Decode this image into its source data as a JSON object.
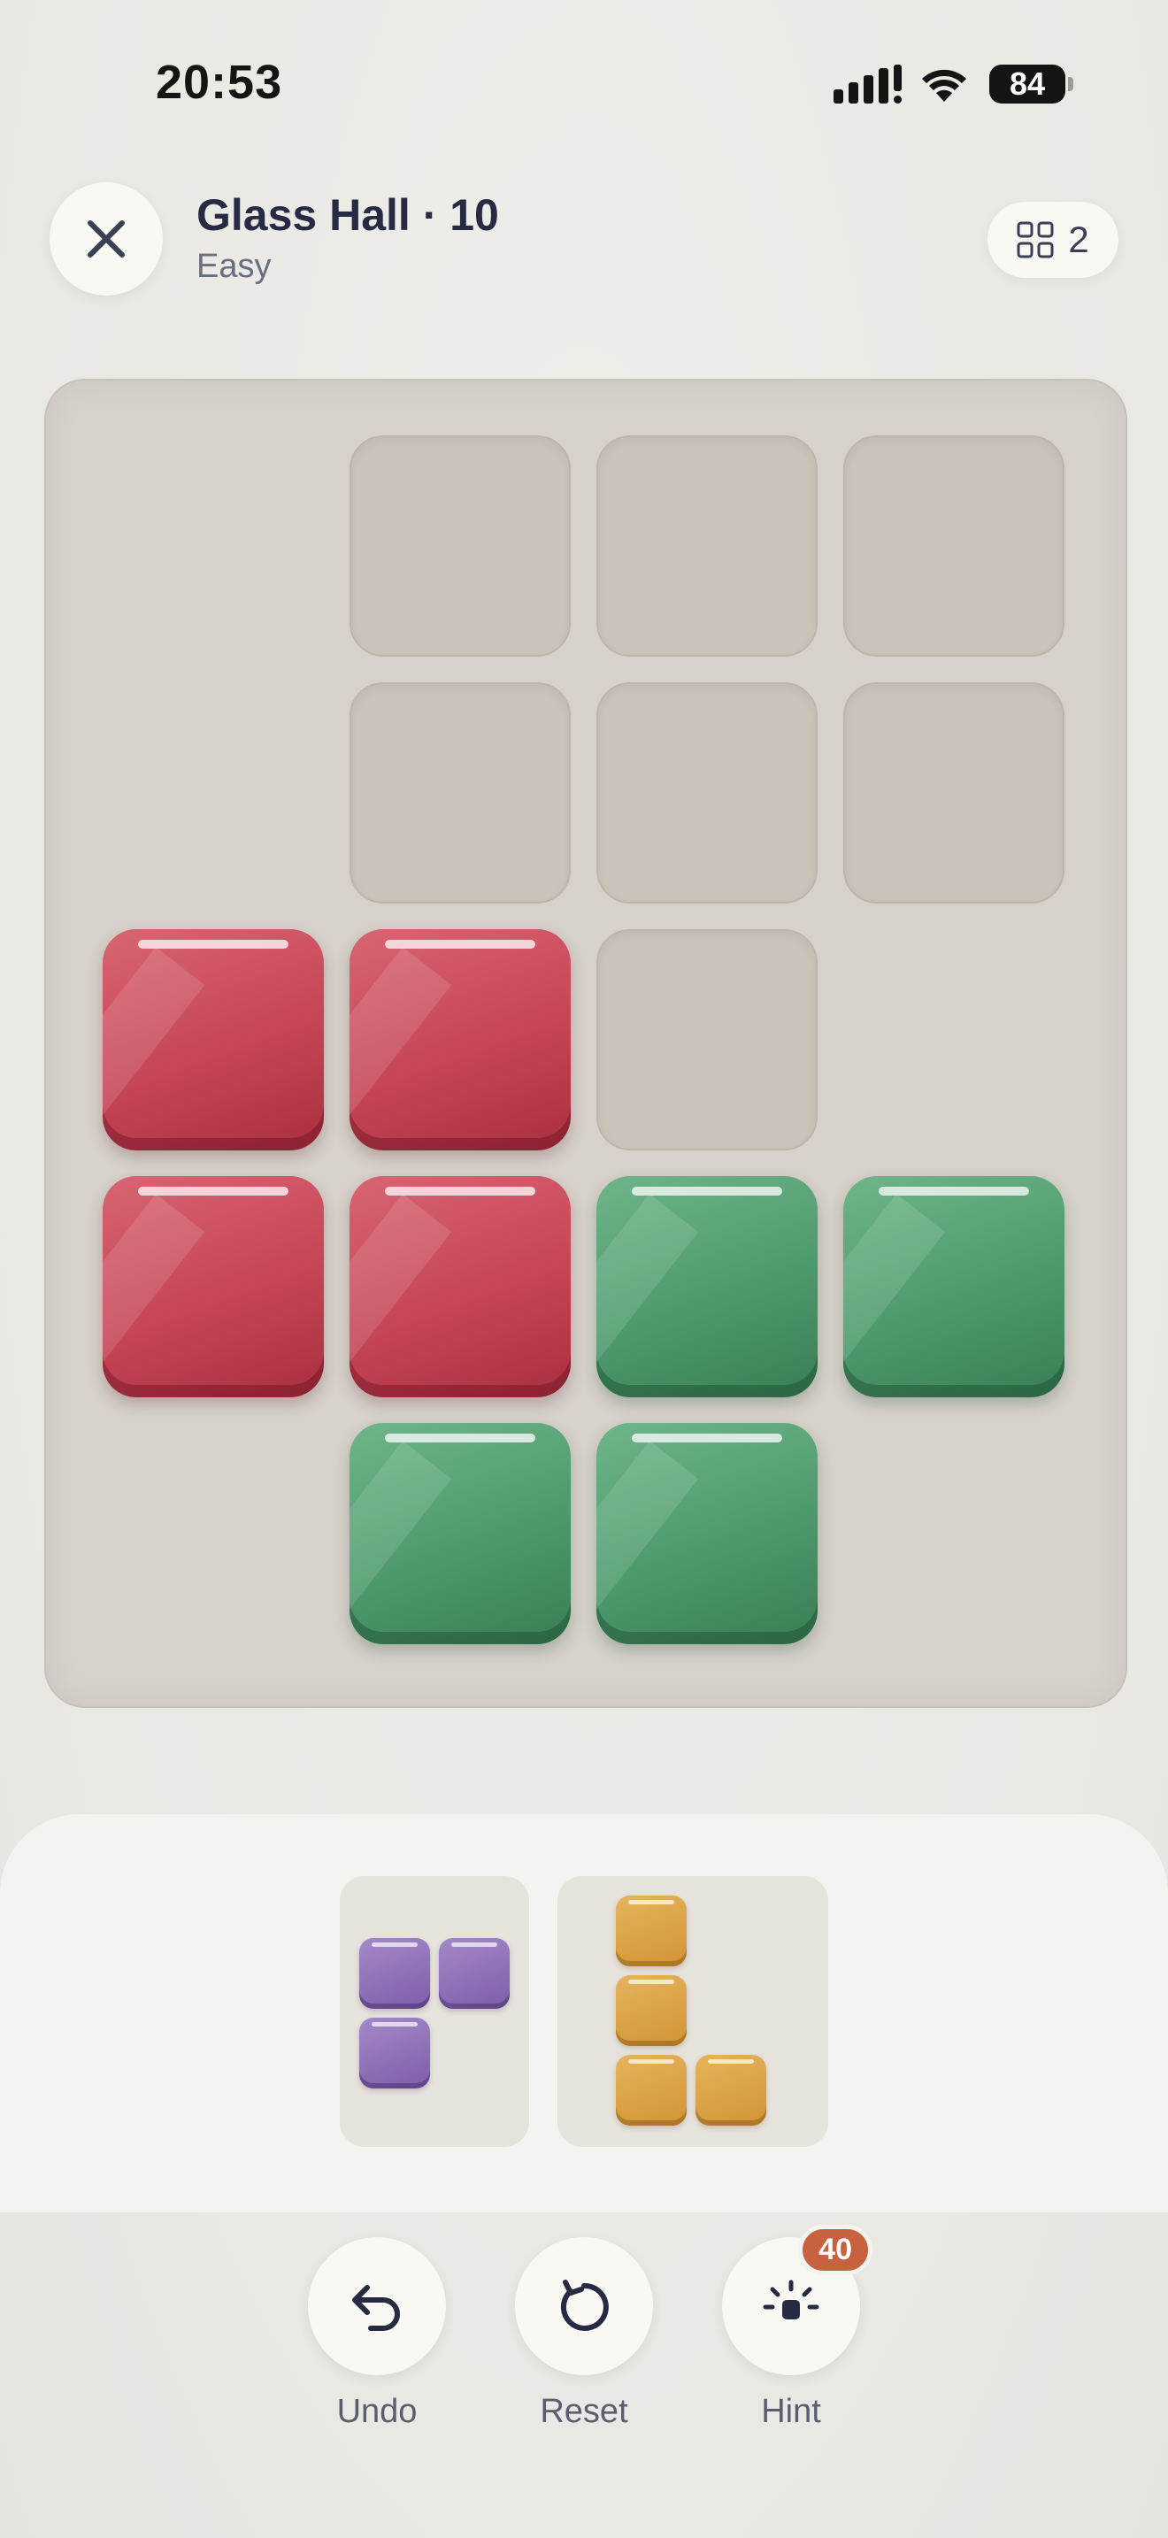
{
  "status_bar": {
    "time": "20:53",
    "battery": "84"
  },
  "header": {
    "title": "Glass Hall · 10",
    "difficulty": "Easy",
    "count": "2"
  },
  "colors": {
    "red": "#c64557",
    "green": "#4d9a6d",
    "purple": "#8c6db8",
    "orange": "#d9a040",
    "badge": "#c8613e"
  },
  "board": {
    "rows": 5,
    "cols": 4,
    "cells": [
      [
        "none",
        "empty",
        "empty",
        "empty"
      ],
      [
        "none",
        "empty",
        "empty",
        "empty"
      ],
      [
        "red",
        "red",
        "empty",
        "none"
      ],
      [
        "red",
        "red",
        "green",
        "green"
      ],
      [
        "none",
        "green",
        "green",
        "none"
      ]
    ]
  },
  "pieces": [
    {
      "color": "purple",
      "shape": [
        [
          1,
          1
        ],
        [
          1,
          0
        ]
      ]
    },
    {
      "color": "orange",
      "shape": [
        [
          1,
          0
        ],
        [
          1,
          0
        ],
        [
          1,
          1
        ]
      ]
    }
  ],
  "controls": {
    "undo": "Undo",
    "reset": "Reset",
    "hint": "Hint",
    "hint_count": "40"
  }
}
